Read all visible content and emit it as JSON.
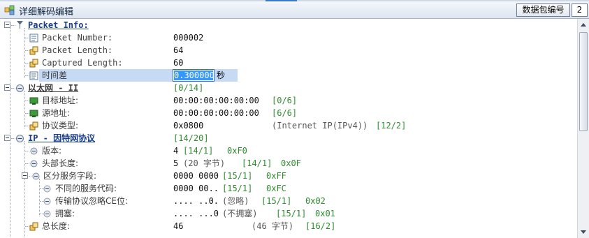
{
  "panel": {
    "title": "详细解码编辑",
    "packet_number_label": "数据包编号",
    "packet_number_value": "2"
  },
  "tree": {
    "packet_info": {
      "label": "Packet Info:",
      "packet_number": {
        "label": "Packet Number:",
        "value": "000002"
      },
      "packet_length": {
        "label": "Packet Length:",
        "value": "64"
      },
      "captured_length": {
        "label": "Captured Length:",
        "value": "60"
      },
      "time_delta": {
        "label": "时间差",
        "value": "0.300000",
        "unit": "秒"
      }
    },
    "ethernet": {
      "label": "以太网 - II",
      "offset": "[0/14]",
      "dest": {
        "label": "目标地址:",
        "value": "00:00:00:00:00:00",
        "offset": "[0/6]"
      },
      "src": {
        "label": "源地址:",
        "value": "00:00:00:00:00:00",
        "offset": "[6/6]"
      },
      "type": {
        "label": "协议类型:",
        "value": "0x0800",
        "desc": "(Internet IP(IPv4))",
        "offset": "[12/2]"
      }
    },
    "ip": {
      "label": "IP - 因特网协议",
      "offset": "[14/20]",
      "version": {
        "label": "版本:",
        "value": "4",
        "offset": "[14/1]",
        "hex": "0xF0"
      },
      "header_length": {
        "label": "头部长度:",
        "value": "5",
        "desc": "(20 字节)",
        "offset": "[14/1]",
        "hex": "0x0F"
      },
      "dsf": {
        "label": "区分服务字段:",
        "value": "0000 0000",
        "offset": "[15/1]",
        "hex": "0xFF",
        "dscp": {
          "label": "不同的服务代码:",
          "value": "0000 00..",
          "offset": "[15/1]",
          "hex": "0xFC"
        },
        "ect": {
          "label": "传输协议忽略CE位:",
          "value": ".... ..0.",
          "desc": "(忽略)",
          "offset": "[15/1]",
          "hex": "0x02"
        },
        "ce": {
          "label": "拥塞:",
          "value": ".... ...0",
          "desc": "(不拥塞)",
          "offset": "[15/1]",
          "hex": "0x01"
        }
      },
      "total_length": {
        "label": "总长度:",
        "value": "46",
        "desc": "(46 字节)",
        "offset": "[16/2]"
      }
    }
  },
  "icons": {
    "title": "packet-decode-icon",
    "field": "field-icon",
    "address": "network-address-icon",
    "section": "protocol-section-icon"
  },
  "colors": {
    "section_label": "#1a3e8c",
    "offset_green": "#2e8b2e",
    "selection": "#c6daf6",
    "edit_highlight": "#3399ff"
  }
}
